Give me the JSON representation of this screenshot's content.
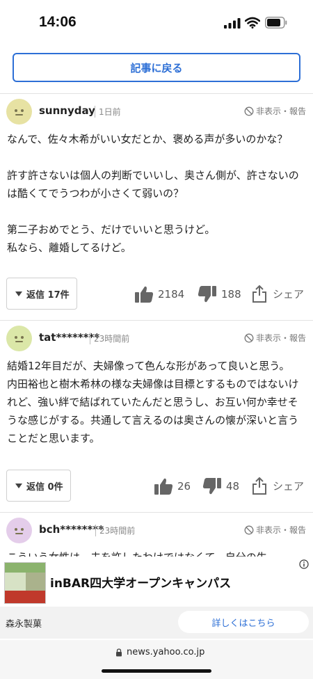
{
  "status_bar": {
    "time": "14:06"
  },
  "header": {
    "back_label": "記事に戻る"
  },
  "comments": [
    {
      "username": "sunnyday",
      "time": "1日前",
      "hide_report": "非表示・報告",
      "body": "なんで、佐々木希がいい女だとか、褒める声が多いのかな？\n\n許す許さないは個人の判断でいいし、奥さん側が、許さないのは酷くてでうつわが小さくて弱いの？\n\n第二子おめでとう、だけでいいと思うけど。\n私なら、離婚してるけど。",
      "reply_label": "返信 17件",
      "likes": "2184",
      "dislikes": "188",
      "share_label": "シェア",
      "avatar_color": "#e7e2a3"
    },
    {
      "username": "tat********",
      "time": "23時間前",
      "hide_report": "非表示・報告",
      "body": "結婚12年目だが、夫婦像って色んな形があって良いと思う。\n内田裕也と樹木希林の様な夫婦像は目標とするものではないけれど、強い絆で結ばれていたんだと思うし、お互い何か幸せそうな感じがする。共通して言えるのは奥さんの懐が深いと言うことだと思います。",
      "reply_label": "返信 0件",
      "likes": "26",
      "dislikes": "48",
      "share_label": "シェア",
      "avatar_color": "#dbe7a8"
    },
    {
      "username": "bch********",
      "time": "23時間前",
      "hide_report": "非表示・報告",
      "body_partial": "こういう女性は、夫を許したわけではなくて、自分の生",
      "avatar_color": "#e4cdea"
    }
  ],
  "ad": {
    "title": "inBAR四大学オープンキャンパス",
    "advertiser": "森永製菓",
    "cta_label": "詳しくはこちら"
  },
  "address_bar": {
    "url": "news.yahoo.co.jp"
  }
}
